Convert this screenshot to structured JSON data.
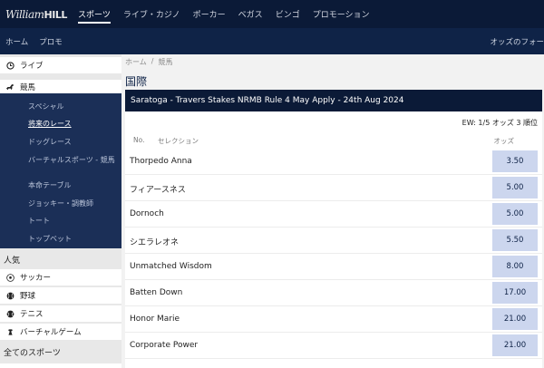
{
  "header": {
    "logo_text_italic": "William",
    "logo_text_bold": "HILL",
    "nav": [
      {
        "label": "スポーツ",
        "active": true
      },
      {
        "label": "ライブ・カジノ",
        "active": false
      },
      {
        "label": "ポーカー",
        "active": false
      },
      {
        "label": "ベガス",
        "active": false
      },
      {
        "label": "ビンゴ",
        "active": false
      },
      {
        "label": "プロモーション",
        "active": false
      }
    ]
  },
  "subheader": {
    "items": [
      "ホーム",
      "プロモ"
    ],
    "odds_format_label": "オッズのフォー"
  },
  "sidebar": {
    "live": {
      "label": "ライブ",
      "icon": "clock-icon"
    },
    "horse_racing": {
      "label": "競馬",
      "icon": "horse-icon"
    },
    "horse_racing_sub": [
      {
        "label": "スペシャル",
        "current": false
      },
      {
        "label": "将来のレース",
        "current": true
      },
      {
        "label": "ドッグレース",
        "current": false
      },
      {
        "label": "バーチャルスポーツ - 競馬",
        "current": false
      },
      {
        "label": "本命テーブル",
        "current": false
      },
      {
        "label": "ジョッキー・調教師",
        "current": false
      },
      {
        "label": "トート",
        "current": false
      },
      {
        "label": "トップベット",
        "current": false
      }
    ],
    "popular_heading": "人気",
    "popular": [
      {
        "label": "サッカー",
        "icon": "soccer-ball-icon"
      },
      {
        "label": "野球",
        "icon": "baseball-icon"
      },
      {
        "label": "テニス",
        "icon": "tennis-ball-icon"
      },
      {
        "label": "バーチャルゲーム",
        "icon": "virtual-game-icon"
      }
    ],
    "all_sports_heading": "全てのスポーツ"
  },
  "breadcrumb": [
    "ホーム",
    "/",
    "競馬"
  ],
  "page_title": "国際",
  "event": {
    "title": "Saratoga - Travers Stakes NRMB Rule 4 May Apply - 24th Aug 2024",
    "each_way_terms": "EW: 1/5 オッズ 3 順位",
    "columns": {
      "no": "No.",
      "selection": "セレクション",
      "odds": "オッズ"
    },
    "runners": [
      {
        "name": "Thorpedo Anna",
        "odds": "3.50"
      },
      {
        "name": "フィアースネス",
        "odds": "5.00"
      },
      {
        "name": "Dornoch",
        "odds": "5.00"
      },
      {
        "name": "シエラレオネ",
        "odds": "5.50"
      },
      {
        "name": "Unmatched Wisdom",
        "odds": "8.00"
      },
      {
        "name": "Batten Down",
        "odds": "17.00"
      },
      {
        "name": "Honor Marie",
        "odds": "21.00"
      },
      {
        "name": "Corporate Power",
        "odds": "21.00"
      }
    ]
  }
}
